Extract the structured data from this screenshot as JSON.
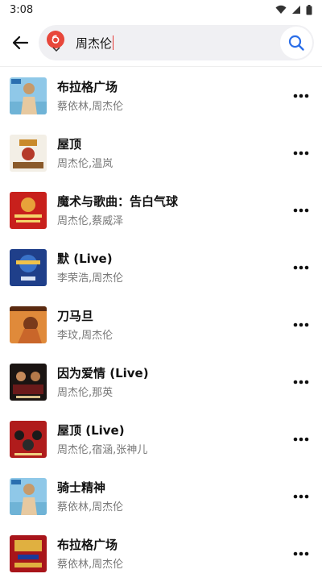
{
  "status": {
    "time": "3:08"
  },
  "search": {
    "query": "周杰伦"
  },
  "songs": [
    {
      "title": "布拉格广场",
      "artists": "蔡依林,周杰伦"
    },
    {
      "title": "屋顶",
      "artists": "周杰伦,温岚"
    },
    {
      "title": "魔术与歌曲：告白气球",
      "artists": "周杰伦,蔡威泽"
    },
    {
      "title": "默 (Live)",
      "artists": "李荣浩,周杰伦"
    },
    {
      "title": "刀马旦",
      "artists": "李玟,周杰伦"
    },
    {
      "title": "因为爱情 (Live)",
      "artists": "周杰伦,那英"
    },
    {
      "title": "屋顶 (Live)",
      "artists": "周杰伦,宿涵,张神儿"
    },
    {
      "title": "骑士精神",
      "artists": "蔡依林,周杰伦"
    },
    {
      "title": "布拉格广场",
      "artists": "蔡依林,周杰伦"
    }
  ],
  "colors": {
    "accent": "#2b6ee8",
    "logo": "#e8473b"
  }
}
